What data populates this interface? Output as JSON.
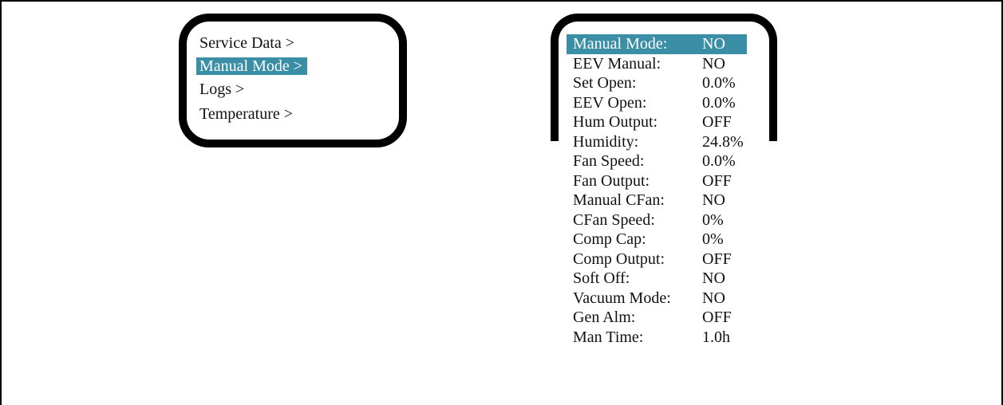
{
  "menu": {
    "items": [
      {
        "label": "Service Data >",
        "selected": false
      },
      {
        "label": "Manual Mode >",
        "selected": true
      },
      {
        "label": "Logs >",
        "selected": false
      },
      {
        "label": "Temperature >",
        "selected": false
      }
    ]
  },
  "manual_mode": {
    "rows": [
      {
        "name": "Manual Mode:",
        "value": "NO",
        "selected": true
      },
      {
        "name": "EEV Manual:",
        "value": "NO",
        "selected": false
      },
      {
        "name": "Set Open:",
        "value": "0.0%",
        "selected": false
      },
      {
        "name": "EEV Open:",
        "value": "0.0%",
        "selected": false
      },
      {
        "name": "Hum Output:",
        "value": "OFF",
        "selected": false
      },
      {
        "name": "Humidity:",
        "value": "24.8%",
        "selected": false
      },
      {
        "name": "Fan Speed:",
        "value": "0.0%",
        "selected": false
      },
      {
        "name": "Fan Output:",
        "value": "OFF",
        "selected": false
      },
      {
        "name": "Manual CFan:",
        "value": "NO",
        "selected": false
      },
      {
        "name": "CFan Speed:",
        "value": "0%",
        "selected": false
      },
      {
        "name": "Comp Cap:",
        "value": "0%",
        "selected": false
      },
      {
        "name": "Comp Output:",
        "value": "OFF",
        "selected": false
      },
      {
        "name": "Soft Off:",
        "value": "NO",
        "selected": false
      },
      {
        "name": "Vacuum Mode:",
        "value": "NO",
        "selected": false
      },
      {
        "name": "Gen Alm:",
        "value": "OFF",
        "selected": false
      },
      {
        "name": "Man Time:",
        "value": "1.0h",
        "selected": false
      }
    ]
  },
  "colors": {
    "highlight": "#3a8fa6",
    "highlight_text": "#ffffff",
    "bezel": "#000000"
  }
}
